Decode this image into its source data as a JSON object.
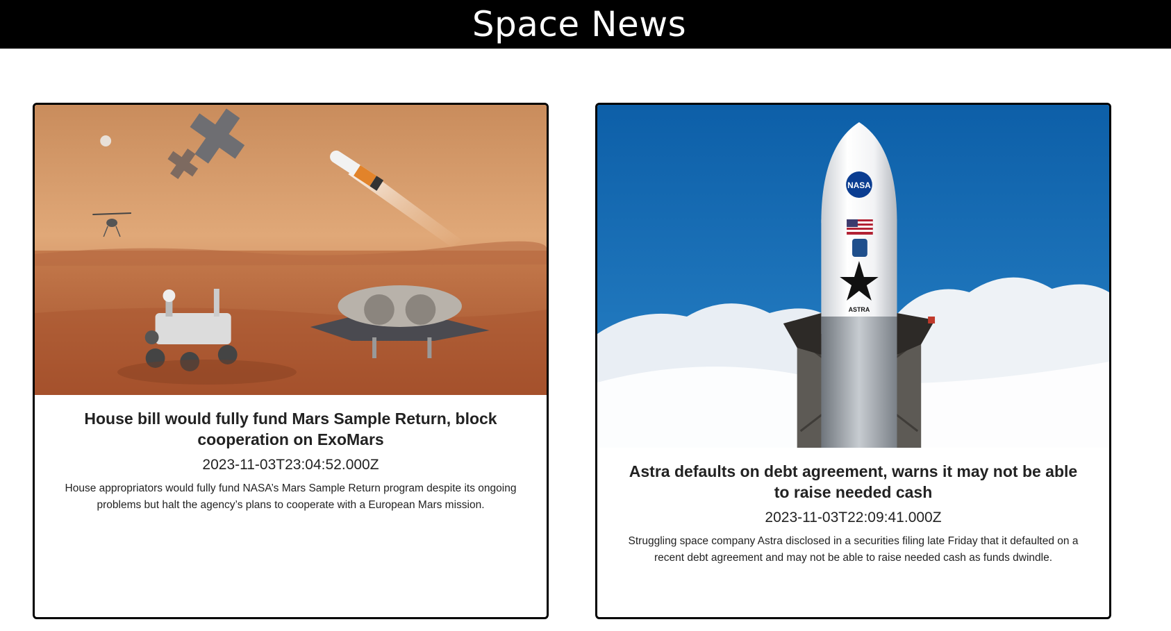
{
  "header": {
    "title": "Space News"
  },
  "articles": [
    {
      "title": "House bill would fully fund Mars Sample Return, block cooperation on ExoMars",
      "published_at": "2023-11-03T23:04:52.000Z",
      "summary": "House appropriators would fully fund NASA’s Mars Sample Return program despite its ongoing problems but halt the agency’s plans to cooperate with a European Mars mission.",
      "image": "mars-sample-return-illustration"
    },
    {
      "title": "Astra defaults on debt agreement, warns it may not be able to raise needed cash",
      "published_at": "2023-11-03T22:09:41.000Z",
      "summary": "Struggling space company Astra disclosed in a securities filing late Friday that it defaulted on a recent debt agreement and may not be able to raise needed cash as funds dwindle.",
      "image": "astra-rocket-nasa-photo",
      "rocket_labels": {
        "agency": "NASA",
        "brand": "ASTRA"
      }
    }
  ]
}
